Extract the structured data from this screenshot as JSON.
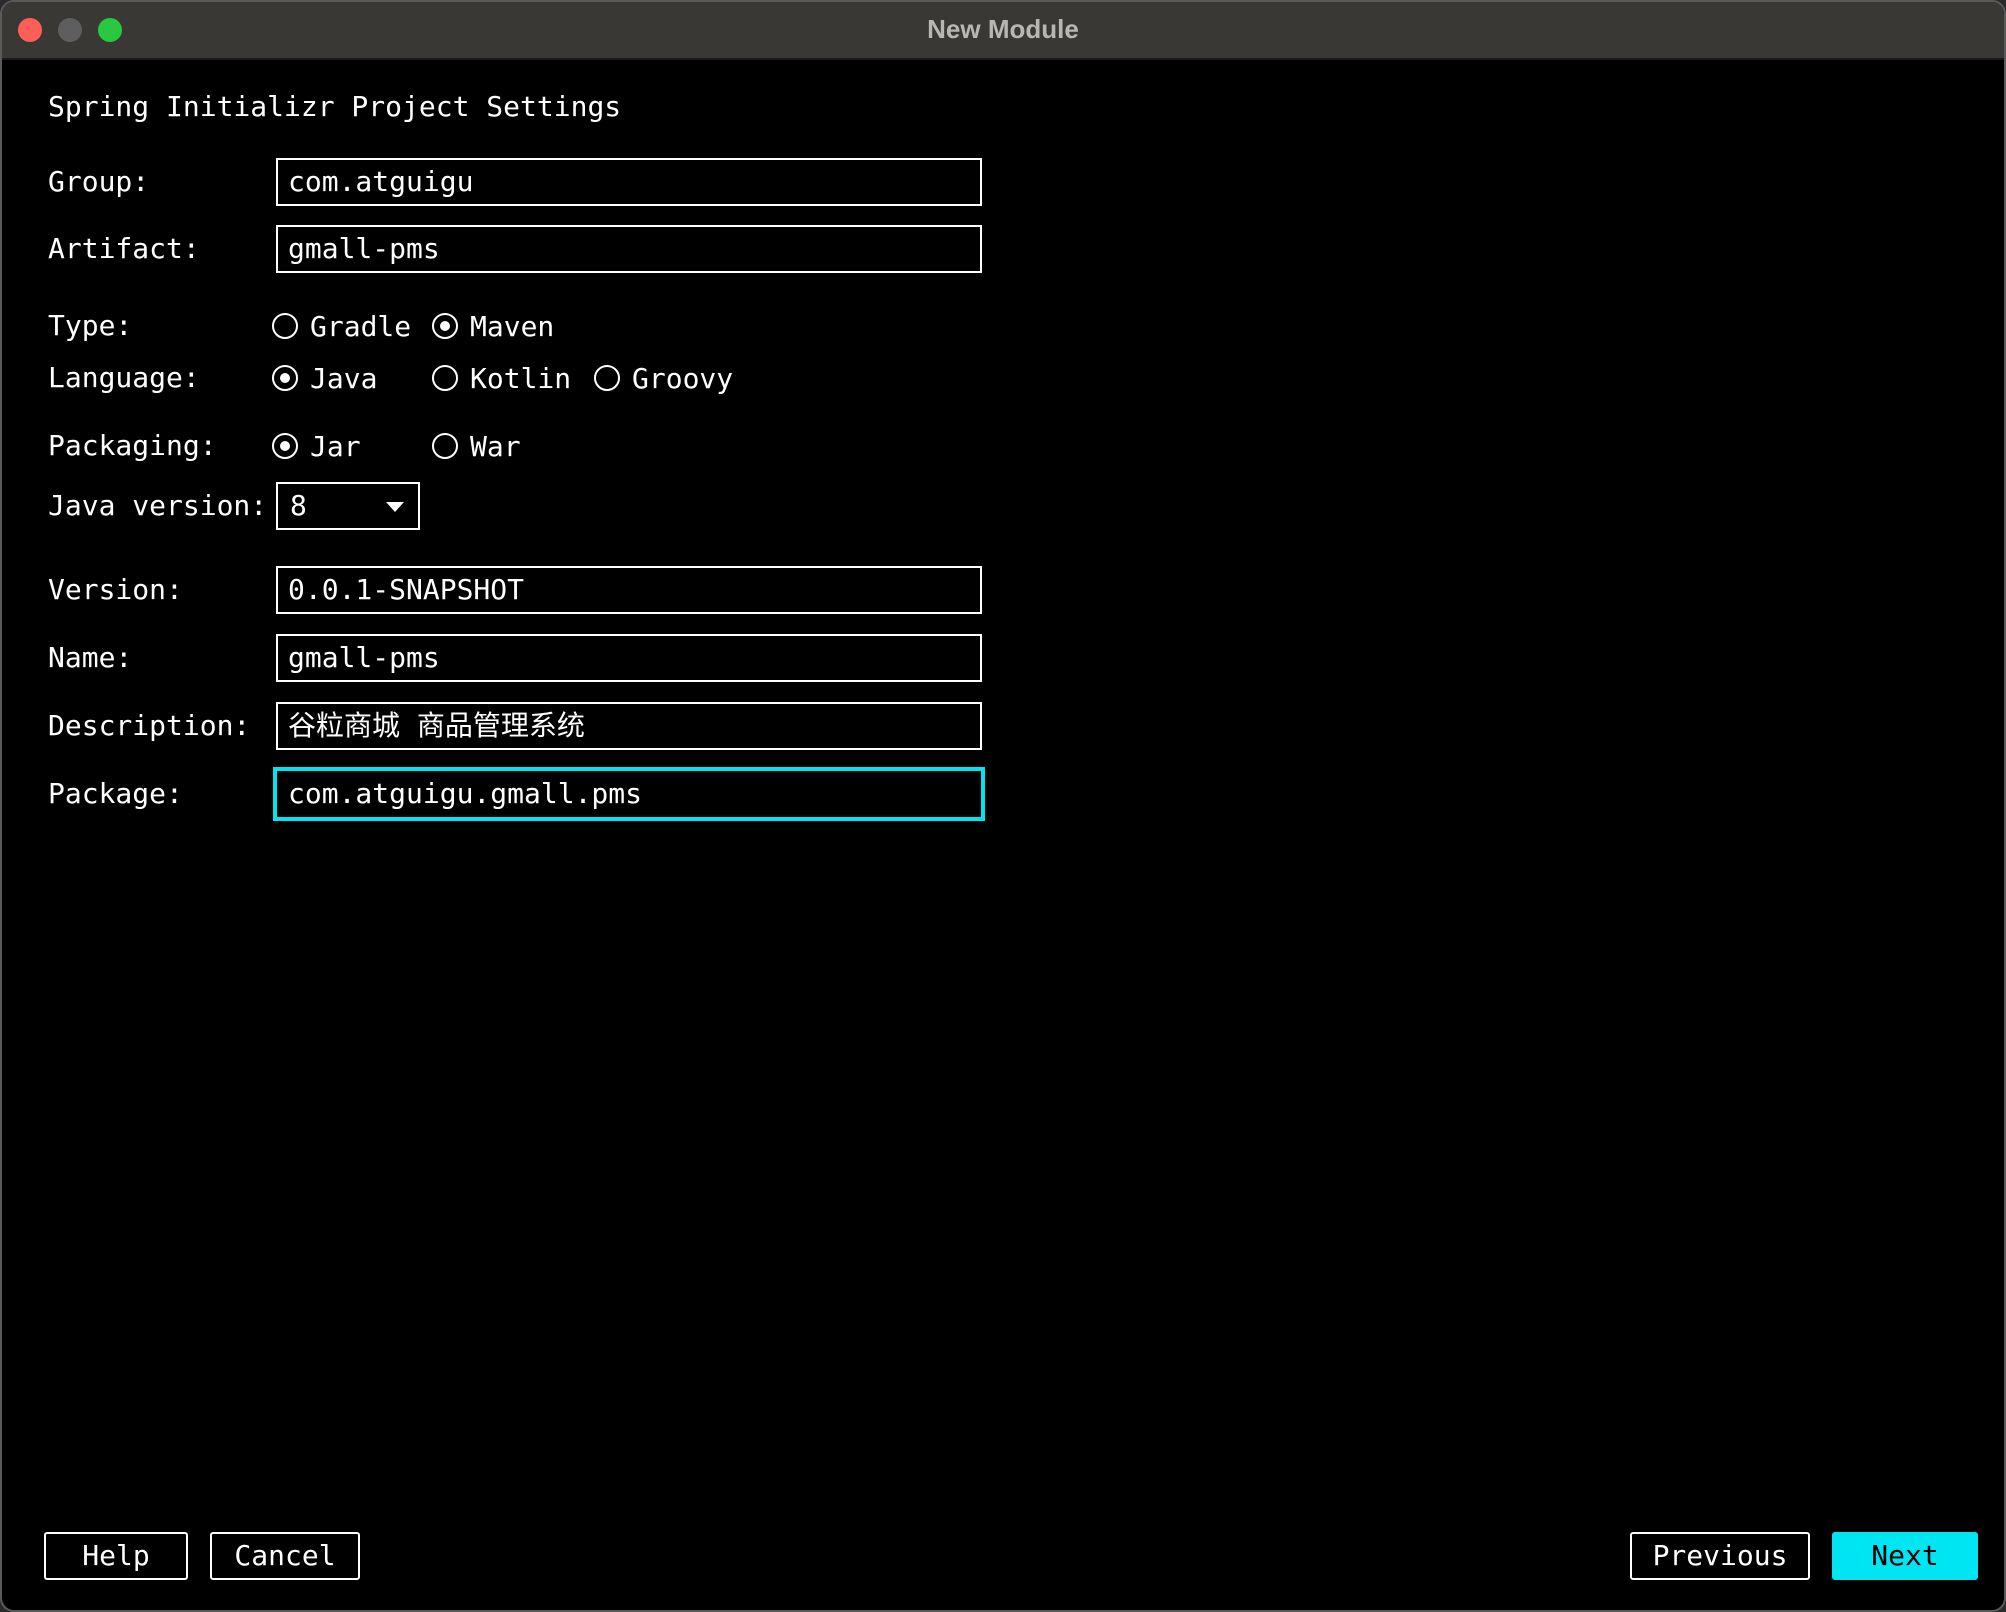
{
  "window": {
    "title": "New Module"
  },
  "form": {
    "section_title": "Spring Initializr Project Settings",
    "group": {
      "label": "Group:",
      "value": "com.atguigu"
    },
    "artifact": {
      "label": "Artifact:",
      "value": "gmall-pms"
    },
    "type": {
      "label": "Type:",
      "options": [
        {
          "label": "Gradle",
          "checked": false
        },
        {
          "label": "Maven",
          "checked": true
        }
      ]
    },
    "language": {
      "label": "Language:",
      "options": [
        {
          "label": "Java",
          "checked": true
        },
        {
          "label": "Kotlin",
          "checked": false
        },
        {
          "label": "Groovy",
          "checked": false
        }
      ]
    },
    "packaging": {
      "label": "Packaging:",
      "options": [
        {
          "label": "Jar",
          "checked": true
        },
        {
          "label": "War",
          "checked": false
        }
      ]
    },
    "java_version": {
      "label": "Java version:",
      "value": "8"
    },
    "version": {
      "label": "Version:",
      "value": "0.0.1-SNAPSHOT"
    },
    "name": {
      "label": "Name:",
      "value": "gmall-pms"
    },
    "description": {
      "label": "Description:",
      "value": "谷粒商城 商品管理系统"
    },
    "package": {
      "label": "Package:",
      "value": "com.atguigu.gmall.pms"
    }
  },
  "buttons": {
    "help": "Help",
    "cancel": "Cancel",
    "previous": "Previous",
    "next": "Next"
  },
  "colors": {
    "accent": "#00e5f2",
    "background": "#000000",
    "titlebar": "#3a3835"
  }
}
